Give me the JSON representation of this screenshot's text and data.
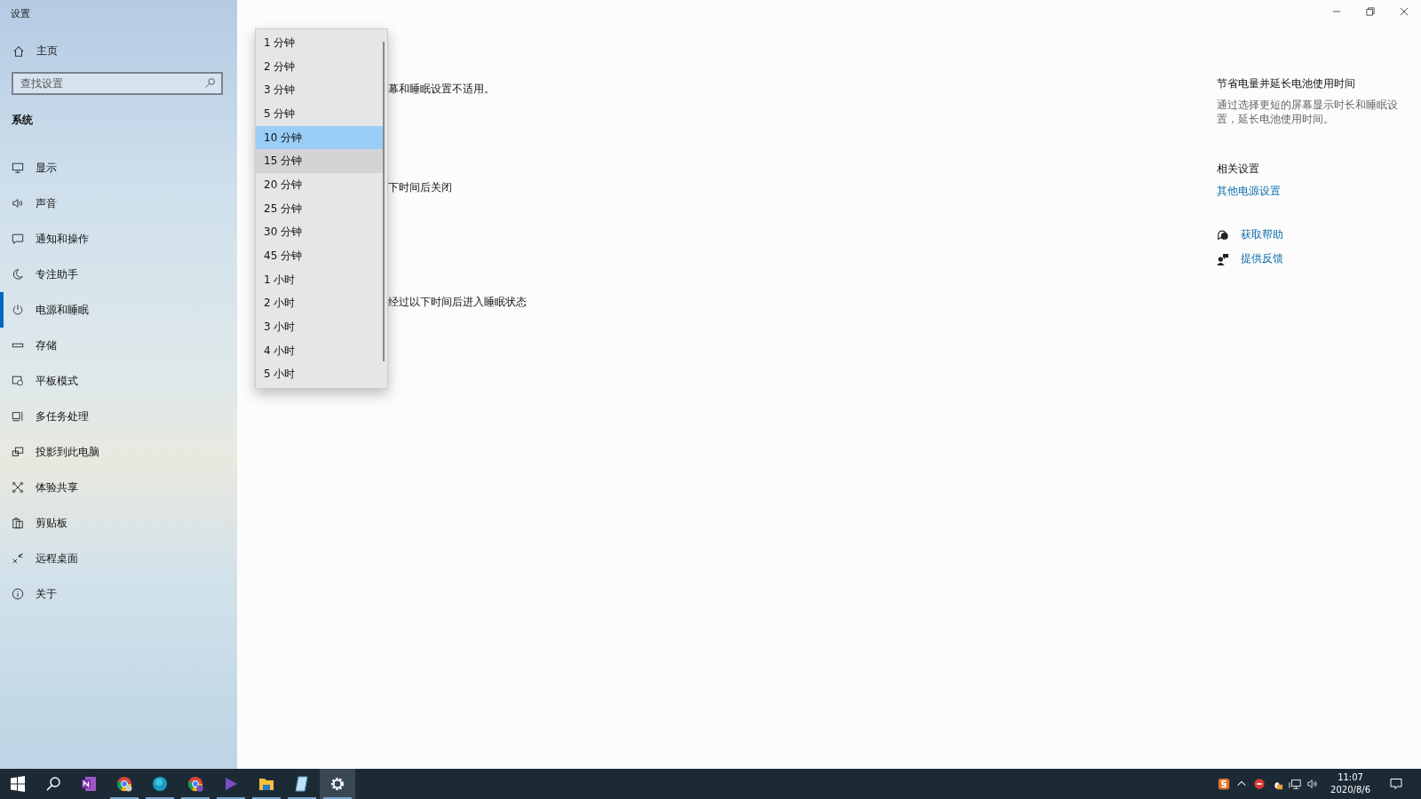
{
  "window": {
    "title": "设置"
  },
  "sidebar": {
    "home": "主页",
    "search": {
      "placeholder": "查找设置"
    },
    "section": "系统",
    "items": [
      {
        "label": "显示",
        "kind": "display",
        "selected": false
      },
      {
        "label": "声音",
        "kind": "sound",
        "selected": false
      },
      {
        "label": "通知和操作",
        "kind": "notify",
        "selected": false
      },
      {
        "label": "专注助手",
        "kind": "moon",
        "selected": false
      },
      {
        "label": "电源和睡眠",
        "kind": "power",
        "selected": true
      },
      {
        "label": "存储",
        "kind": "storage",
        "selected": false
      },
      {
        "label": "平板模式",
        "kind": "tablet",
        "selected": false
      },
      {
        "label": "多任务处理",
        "kind": "multitask",
        "selected": false
      },
      {
        "label": "投影到此电脑",
        "kind": "project",
        "selected": false
      },
      {
        "label": "体验共享",
        "kind": "share",
        "selected": false
      },
      {
        "label": "剪贴板",
        "kind": "clipboard",
        "selected": false
      },
      {
        "label": "远程桌面",
        "kind": "remote",
        "selected": false
      },
      {
        "label": "关于",
        "kind": "info",
        "selected": false
      }
    ]
  },
  "content": {
    "lines": [
      "幕和睡眠设置不适用。",
      "下时间后关闭",
      "经过以下时间后进入睡眠状态"
    ]
  },
  "dropdown": {
    "options": [
      {
        "label": "1 分钟",
        "selected": false,
        "hovered": false
      },
      {
        "label": "2 分钟",
        "selected": false,
        "hovered": false
      },
      {
        "label": "3 分钟",
        "selected": false,
        "hovered": false
      },
      {
        "label": "5 分钟",
        "selected": false,
        "hovered": false
      },
      {
        "label": "10 分钟",
        "selected": true,
        "hovered": false
      },
      {
        "label": "15 分钟",
        "selected": false,
        "hovered": true
      },
      {
        "label": "20 分钟",
        "selected": false,
        "hovered": false
      },
      {
        "label": "25 分钟",
        "selected": false,
        "hovered": false
      },
      {
        "label": "30 分钟",
        "selected": false,
        "hovered": false
      },
      {
        "label": "45 分钟",
        "selected": false,
        "hovered": false
      },
      {
        "label": "1 小时",
        "selected": false,
        "hovered": false
      },
      {
        "label": "2 小时",
        "selected": false,
        "hovered": false
      },
      {
        "label": "3 小时",
        "selected": false,
        "hovered": false
      },
      {
        "label": "4 小时",
        "selected": false,
        "hovered": false
      },
      {
        "label": "5 小时",
        "selected": false,
        "hovered": false
      }
    ]
  },
  "aside": {
    "title": "节省电量并延长电池使用时间",
    "description": "通过选择更短的屏幕显示时长和睡眠设置，延长电池使用时间。",
    "related_title": "相关设置",
    "related_link": "其他电源设置",
    "help": [
      {
        "label": "获取帮助",
        "kind": "help"
      },
      {
        "label": "提供反馈",
        "kind": "feedback"
      }
    ]
  },
  "taskbar": {
    "apps": [
      {
        "kind": "onenote",
        "running": false,
        "active": false
      },
      {
        "kind": "chrome",
        "running": true,
        "active": false
      },
      {
        "kind": "edge",
        "running": true,
        "active": false
      },
      {
        "kind": "chrome-lock",
        "running": true,
        "active": false
      },
      {
        "kind": "media",
        "running": true,
        "active": false
      },
      {
        "kind": "folder",
        "running": true,
        "active": false
      },
      {
        "kind": "notepad",
        "running": true,
        "active": false
      },
      {
        "kind": "settings",
        "running": true,
        "active": true
      }
    ],
    "time": "11:07",
    "date": "2020/8/6"
  }
}
